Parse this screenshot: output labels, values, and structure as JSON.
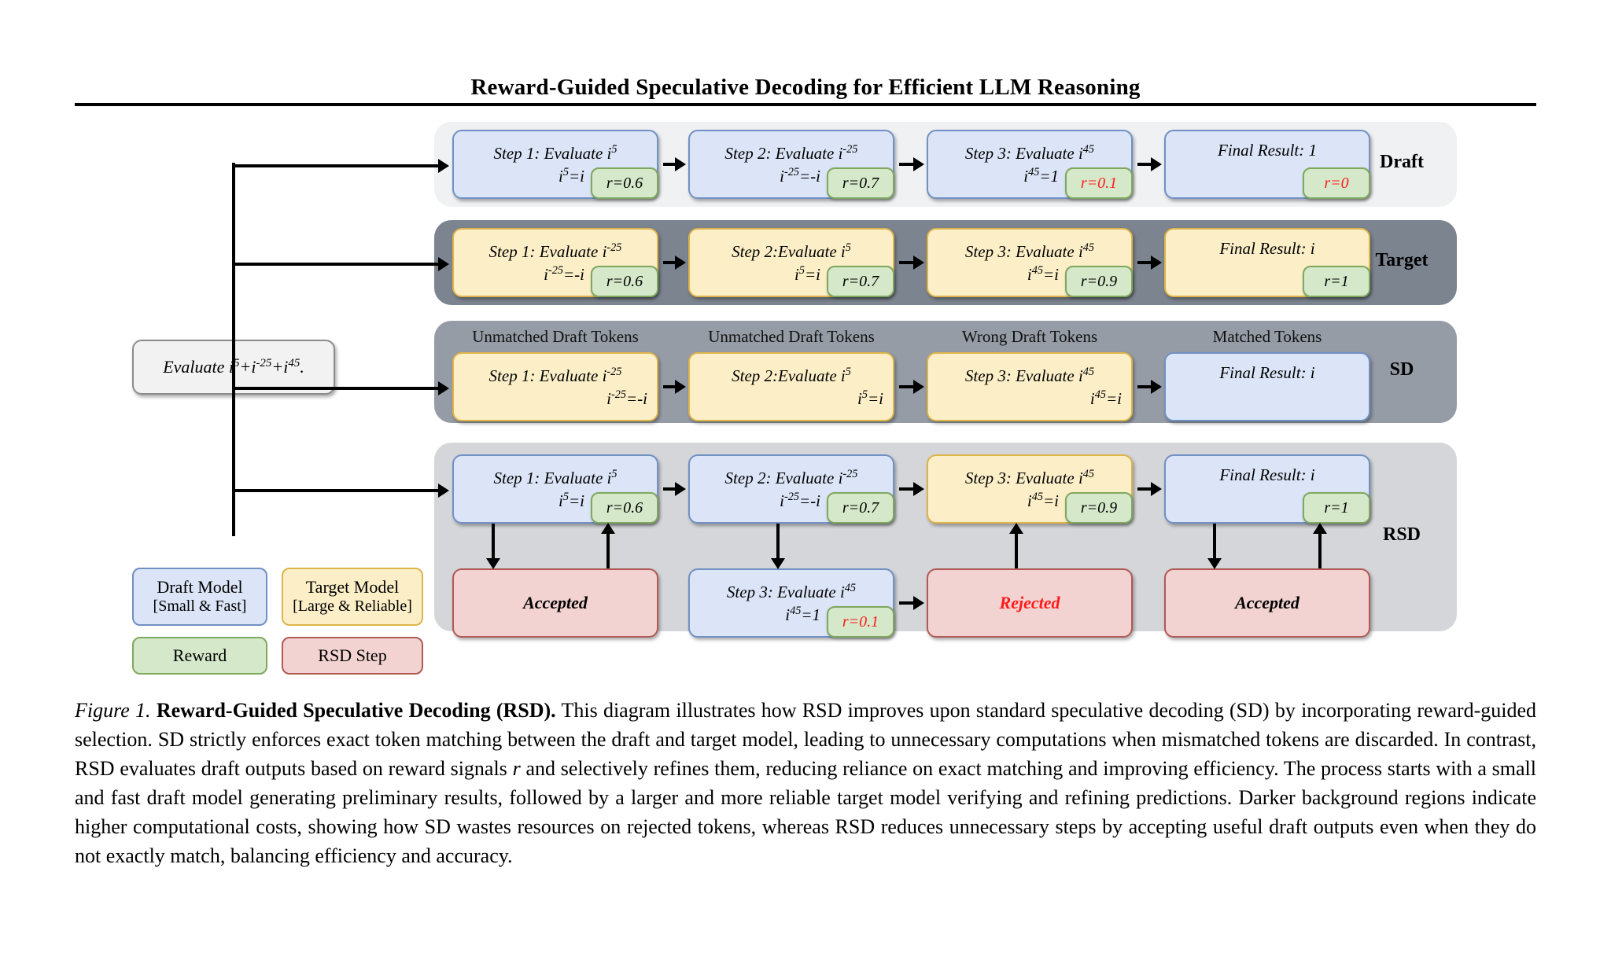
{
  "header": {
    "paper_title": "Reward-Guided Speculative Decoding for Efficient LLM Reasoning"
  },
  "input_node": {
    "text_prefix": "Evaluate i",
    "full_text": "Evaluate i5+i-25+i45."
  },
  "rows": [
    {
      "id": "draft",
      "label": "Draft",
      "boxes": [
        {
          "line1": "Step 1: Evaluate i",
          "line1_sup": "5",
          "line2": "i",
          "line2_sup": "5",
          "line2_tail": "=i",
          "reward": "r=0.6",
          "reward_red": false,
          "style": "blue"
        },
        {
          "line1": "Step 2: Evaluate i",
          "line1_sup": "-25",
          "line2": "i",
          "line2_sup": "-25",
          "line2_tail": "=-i",
          "reward": "r=0.7",
          "reward_red": false,
          "style": "blue"
        },
        {
          "line1": "Step 3: Evaluate i",
          "line1_sup": "45",
          "line2": "i",
          "line2_sup": "45",
          "line2_tail": "=1",
          "reward": "r=0.1",
          "reward_red": true,
          "style": "blue"
        },
        {
          "line1": "Final Result: 1",
          "line1_sup": "",
          "line2": "",
          "line2_sup": "",
          "line2_tail": "",
          "reward": "r=0",
          "reward_red": true,
          "style": "blue"
        }
      ]
    },
    {
      "id": "target",
      "label": "Target",
      "boxes": [
        {
          "line1": "Step 1: Evaluate i",
          "line1_sup": "-25",
          "line2": "i",
          "line2_sup": "-25",
          "line2_tail": "=-i",
          "reward": "r=0.6",
          "reward_red": false,
          "style": "yellow"
        },
        {
          "line1": "Step 2:Evaluate i",
          "line1_sup": "5",
          "line2": "i",
          "line2_sup": "5",
          "line2_tail": "=i",
          "reward": "r=0.7",
          "reward_red": false,
          "style": "yellow"
        },
        {
          "line1": "Step 3: Evaluate i",
          "line1_sup": "45",
          "line2": "i",
          "line2_sup": "45",
          "line2_tail": "=i",
          "reward": "r=0.9",
          "reward_red": false,
          "style": "yellow"
        },
        {
          "line1": "Final Result: i",
          "line1_sup": "",
          "line2": "",
          "line2_sup": "",
          "line2_tail": "",
          "reward": "r=1",
          "reward_red": false,
          "style": "yellow"
        }
      ]
    },
    {
      "id": "sd",
      "label": "SD",
      "headers": [
        "Unmatched Draft Tokens",
        "Unmatched Draft Tokens",
        "Wrong Draft Tokens",
        "Matched Tokens"
      ],
      "boxes": [
        {
          "line1": "Step 1: Evaluate i",
          "line1_sup": "-25",
          "line2": "i",
          "line2_sup": "-25",
          "line2_tail": "=-i",
          "reward": "",
          "reward_red": false,
          "style": "yellow"
        },
        {
          "line1": "Step 2:Evaluate i",
          "line1_sup": "5",
          "line2": "i",
          "line2_sup": "5",
          "line2_tail": "=i",
          "reward": "",
          "reward_red": false,
          "style": "yellow"
        },
        {
          "line1": "Step 3: Evaluate i",
          "line1_sup": "45",
          "line2": "i",
          "line2_sup": "45",
          "line2_tail": "=i",
          "reward": "",
          "reward_red": false,
          "style": "yellow"
        },
        {
          "line1": "Final Result: i",
          "line1_sup": "",
          "line2": "",
          "line2_sup": "",
          "line2_tail": "",
          "reward": "",
          "reward_red": false,
          "style": "blue"
        }
      ]
    },
    {
      "id": "rsd",
      "label": "RSD",
      "boxes": [
        {
          "line1": "Step 1: Evaluate i",
          "line1_sup": "5",
          "line2": "i",
          "line2_sup": "5",
          "line2_tail": "=i",
          "reward": "r=0.6",
          "reward_red": false,
          "style": "blue"
        },
        {
          "line1": "Step 2: Evaluate i",
          "line1_sup": "-25",
          "line2": "i",
          "line2_sup": "-25",
          "line2_tail": "=-i",
          "reward": "r=0.7",
          "reward_red": false,
          "style": "blue"
        },
        {
          "line1": "Step 3: Evaluate i",
          "line1_sup": "45",
          "line2": "i",
          "line2_sup": "45",
          "line2_tail": "=i",
          "reward": "r=0.9",
          "reward_red": false,
          "style": "yellow"
        },
        {
          "line1": "Final Result: i",
          "line1_sup": "",
          "line2": "",
          "line2_sup": "",
          "line2_tail": "",
          "reward": "r=1",
          "reward_red": false,
          "style": "blue"
        }
      ],
      "bottom_boxes": [
        {
          "kind": "status",
          "text": "Accepted",
          "red": false
        },
        {
          "kind": "step",
          "line1": "Step 3: Evaluate i",
          "line1_sup": "45",
          "line2": "i",
          "line2_sup": "45",
          "line2_tail": "=1",
          "reward": "r=0.1",
          "reward_red": true,
          "style": "blue"
        },
        {
          "kind": "status",
          "text": "Rejected",
          "red": true
        },
        {
          "kind": "status",
          "text": "Accepted",
          "red": false
        }
      ]
    }
  ],
  "legend": [
    {
      "title": "Draft Model",
      "sub": "[Small & Fast]",
      "style": "blue"
    },
    {
      "title": "Target Model",
      "sub": "[Large & Reliable]",
      "style": "yellow"
    },
    {
      "title": "Reward",
      "sub": "",
      "style": "green"
    },
    {
      "title": "RSD Step",
      "sub": "",
      "style": "red"
    }
  ],
  "caption": {
    "figure_number": "Figure 1.",
    "bold_title": "Reward-Guided Speculative Decoding (RSD).",
    "body_part1": " This diagram illustrates how RSD improves upon standard speculative decoding (SD) by incorporating reward-guided selection. SD strictly enforces exact token matching between the draft and target model, leading to unnecessary computations when mismatched tokens are discarded. In contrast, RSD evaluates draft outputs based on reward signals ",
    "italic_r": "r",
    "body_part2": " and selectively refines them, reducing reliance on exact matching and improving efficiency. The process starts with a small and fast draft model generating preliminary results, followed by a larger and more reliable target model verifying and refining predictions. Darker background regions indicate higher computational costs, showing how SD wastes resources on rejected tokens, whereas RSD reduces unnecessary steps by accepting useful draft outputs even when they do not exactly match, balancing efficiency and accuracy."
  },
  "colors": {
    "draft_band": "#f0f1f3",
    "target_band": "#7c8490",
    "sd_band": "#959ca6",
    "rsd_band": "#d4d6d9",
    "blue_box": "#dbe5f7",
    "yellow_box": "#fcefc8",
    "red_box": "#f2d3d1",
    "green_reward": "#d5e8ca",
    "alert_red": "#ff1a1a"
  }
}
